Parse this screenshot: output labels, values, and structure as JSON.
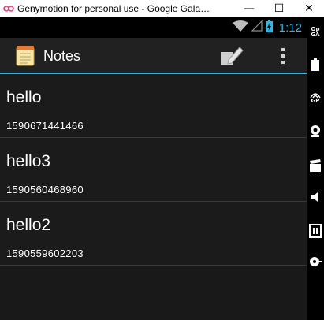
{
  "window": {
    "title": "Genymotion for personal use - Google Gala…",
    "minimize_glyph": "—",
    "maximize_glyph": "☐",
    "close_glyph": "✕"
  },
  "statusbar": {
    "time": "1:12"
  },
  "actionbar": {
    "title": "Notes"
  },
  "notes": [
    {
      "title": "hello",
      "time": "1590671441466"
    },
    {
      "title": "hello3",
      "time": "1590560468960"
    },
    {
      "title": "hello2",
      "time": "1590559602203"
    }
  ],
  "sidebar": {
    "opengl_label_line1": "Op",
    "opengl_label_line2": "GA",
    "gps_label": "GP"
  },
  "colors": {
    "accent": "#33b5e5",
    "actionbar_bg": "#212121",
    "list_bg": "#1b1b1b"
  }
}
